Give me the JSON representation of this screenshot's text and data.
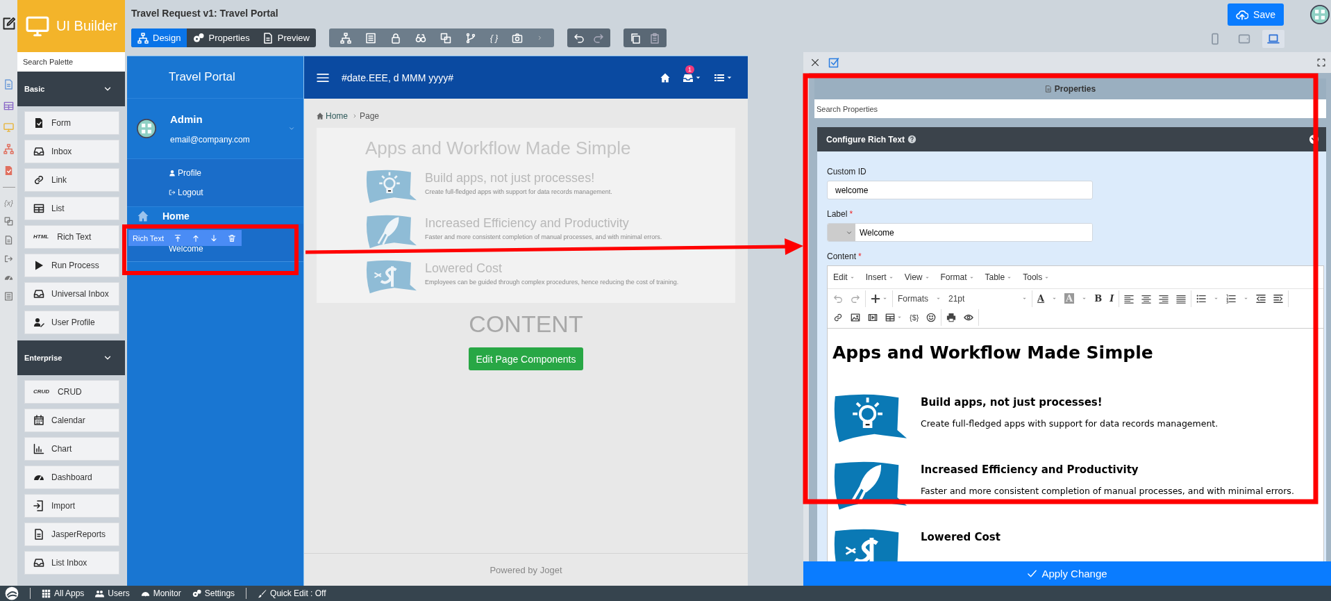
{
  "rail": {
    "variables_label": "{x}"
  },
  "palette": {
    "title": "UI Builder",
    "search_placeholder": "Search Palette",
    "groups": [
      {
        "title": "Basic",
        "expanded": true,
        "items": [
          {
            "label": "Form"
          },
          {
            "label": "Inbox"
          },
          {
            "label": "Link"
          },
          {
            "label": "List"
          },
          {
            "label": "Rich Text",
            "badge": "HTML"
          },
          {
            "label": "Run Process"
          },
          {
            "label": "Universal Inbox"
          },
          {
            "label": "User Profile"
          }
        ]
      },
      {
        "title": "Enterprise",
        "expanded": true,
        "items": [
          {
            "label": "CRUD",
            "badge": "CRUD"
          },
          {
            "label": "Calendar"
          },
          {
            "label": "Chart"
          },
          {
            "label": "Dashboard"
          },
          {
            "label": "Import"
          },
          {
            "label": "JasperReports"
          },
          {
            "label": "List Inbox"
          }
        ]
      }
    ]
  },
  "header": {
    "title": "Travel Request v1: Travel Portal",
    "mode_tabs": [
      {
        "label": "Design",
        "selected": true
      },
      {
        "label": "Properties",
        "selected": false
      },
      {
        "label": "Preview",
        "selected": false
      }
    ],
    "tool_label": "{ }",
    "save_button": "Save",
    "devices": [
      {
        "selected": false
      },
      {
        "selected": false
      },
      {
        "selected": true
      }
    ]
  },
  "canvas": {
    "sidebar": {
      "title": "Travel Portal",
      "user_name": "Admin",
      "user_email": "email@company.com",
      "user_menu": [
        "Profile",
        "Logout"
      ],
      "menu_item": "Home",
      "selected_element": {
        "type": "Rich Text",
        "label": "Welcome"
      }
    },
    "navbar": {
      "date": "#date.EEE, d MMM yyyy#",
      "notification_count": "1"
    },
    "breadcrumb": [
      "Home",
      "Page"
    ],
    "content": {
      "heading": "Apps and Workflow Made Simple",
      "features": [
        {
          "title": "Build apps, not just processes!",
          "description": "Create full-fledged apps with support for data records management."
        },
        {
          "title": "Increased Efficiency and Productivity",
          "description": "Faster and more consistent completion of manual processes, and with minimal errors."
        },
        {
          "title": "Lowered Cost",
          "description": "Employees can be guided through complex procedures, hence reducing the cost of training."
        }
      ]
    },
    "placeholder": "CONTENT",
    "edit_button": "Edit Page Components",
    "footer": "Powered by Joget"
  },
  "properties": {
    "title": "Properties",
    "search_placeholder": "Search Properties",
    "section": "Configure Rich Text",
    "section_expanded": true,
    "fields": [
      {
        "kind": "text",
        "label": "Custom ID",
        "required": false,
        "value": "welcome"
      },
      {
        "kind": "translatable",
        "label": "Label",
        "required": true,
        "value": "Welcome"
      }
    ],
    "content_label": "Content",
    "content_required": true,
    "required_mark": "*",
    "editor": {
      "menus": [
        "Edit",
        "Insert",
        "View",
        "Format",
        "Table",
        "Tools"
      ],
      "formats": "Formats",
      "font_size": "21pt",
      "text_color": "A",
      "background_color": "A",
      "bold": "B",
      "italic": "I",
      "variable": "{$}",
      "heading": "Apps and Workflow Made Simple",
      "features": [
        {
          "title": "Build apps, not just processes!",
          "description": "Create full-fledged apps with support for data records management."
        },
        {
          "title": "Increased Efficiency and Productivity",
          "description": "Faster and more consistent completion of manual processes, and with minimal errors."
        },
        {
          "title": "Lowered Cost"
        }
      ]
    },
    "apply_button": "Apply Change"
  },
  "status_bar": {
    "items": [
      "All Apps",
      "Users",
      "Monitor",
      "Settings"
    ],
    "quick_edit": "Quick Edit : Off"
  }
}
